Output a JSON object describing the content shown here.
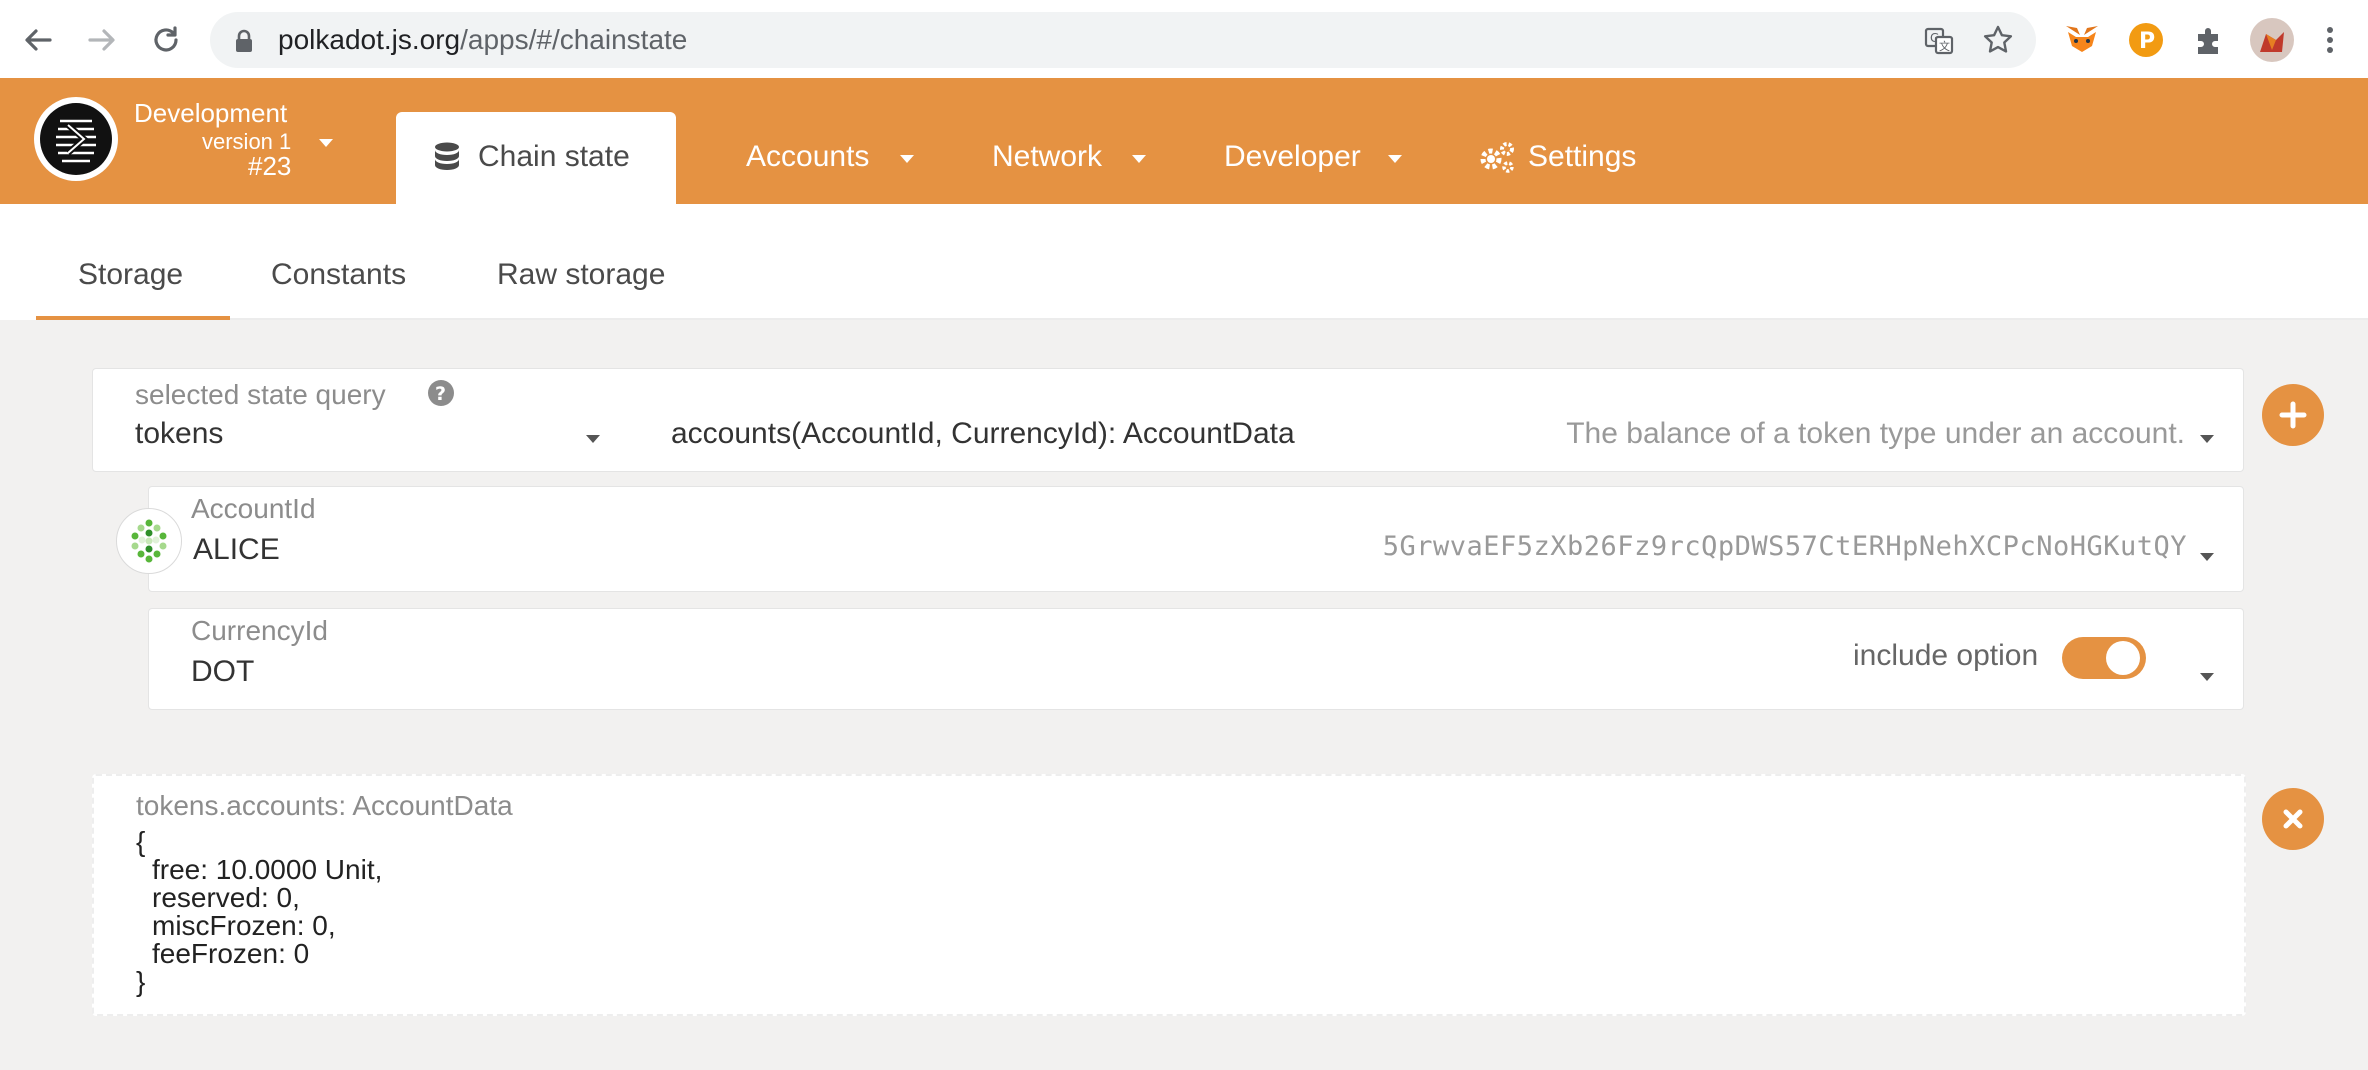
{
  "browser": {
    "url_host": "polkadot.js.org",
    "url_path": "/apps/#/chainstate"
  },
  "header": {
    "chain_name": "Development",
    "version": "version 1",
    "block": "#23",
    "active_tab": "Chain state",
    "menu": [
      "Accounts",
      "Network",
      "Developer",
      "Settings"
    ]
  },
  "subtabs": [
    "Storage",
    "Constants",
    "Raw storage"
  ],
  "query": {
    "label": "selected state query",
    "module": "tokens",
    "method": "accounts(AccountId, CurrencyId): AccountData",
    "description": "The balance of a token type under an account.",
    "account": {
      "label": "AccountId",
      "name": "ALICE",
      "address": "5GrwvaEF5zXb26Fz9rcQpDWS57CtERHpNehXCPcNoHGKutQY"
    },
    "currency": {
      "label": "CurrencyId",
      "value": "DOT",
      "include_option_label": "include option",
      "include_option_on": true
    }
  },
  "result": {
    "title": "tokens.accounts: AccountData",
    "lines": [
      "{",
      "free: 10.0000 Unit,",
      "reserved: 0,",
      "miscFrozen: 0,",
      "feeFrozen: 0",
      "}"
    ]
  },
  "colors": {
    "accent": "#e59242",
    "background": "#f2f1f0"
  }
}
